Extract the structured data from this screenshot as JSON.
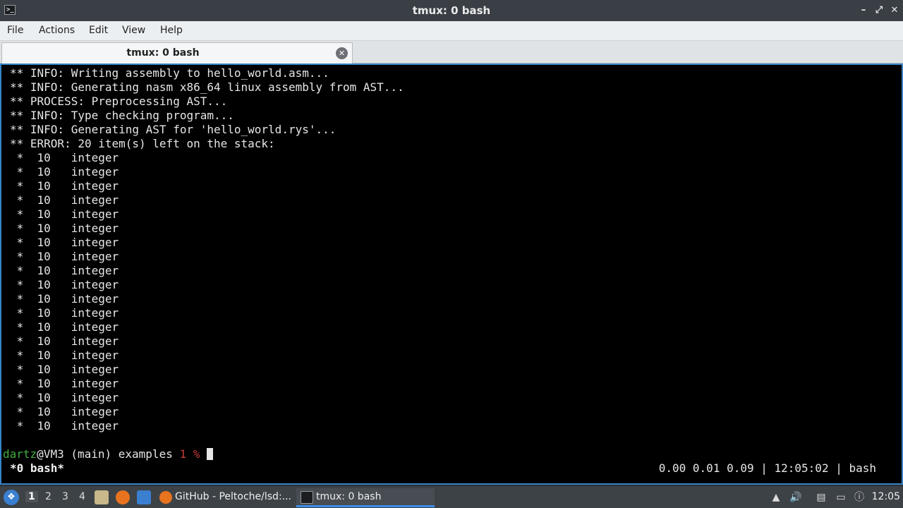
{
  "window": {
    "title": "tmux: 0 bash",
    "minimize": "–",
    "maximize": "⤢",
    "close": "✕"
  },
  "menu": [
    "File",
    "Actions",
    "Edit",
    "View",
    "Help"
  ],
  "tab": {
    "label": "tmux: 0 bash",
    "close": "✕"
  },
  "terminal": {
    "lines": [
      "** INFO: Writing assembly to hello_world.asm...",
      "** INFO: Generating nasm x86_64 linux assembly from AST...",
      "** PROCESS: Preprocessing AST...",
      "** INFO: Type checking program...",
      "** INFO: Generating AST for 'hello_world.rys'...",
      "** ERROR: 20 item(s) left on the stack:",
      " *  10   integer",
      " *  10   integer",
      " *  10   integer",
      " *  10   integer",
      " *  10   integer",
      " *  10   integer",
      " *  10   integer",
      " *  10   integer",
      " *  10   integer",
      " *  10   integer",
      " *  10   integer",
      " *  10   integer",
      " *  10   integer",
      " *  10   integer",
      " *  10   integer",
      " *  10   integer",
      " *  10   integer",
      " *  10   integer",
      " *  10   integer",
      " *  10   integer"
    ],
    "prompt": {
      "user": "dartz",
      "host_rest": "@VM3 (main) examples ",
      "status": "1 %",
      "after": " "
    },
    "status_left": "*0 bash*",
    "status_right": "0.00 0.01 0.09 | 12:05:02 | bash"
  },
  "taskbar": {
    "workspaces": [
      "1",
      "2",
      "3",
      "4"
    ],
    "active_workspace": "1",
    "tasks": [
      {
        "label": "GitHub - Peltoche/lsd:...",
        "icon": "firefox-icon"
      },
      {
        "label": "tmux: 0 bash",
        "icon": "terminal-icon"
      }
    ],
    "clock": "12:05"
  },
  "colors": {
    "accent": "#3584c9",
    "prompt_user": "#3fae3f",
    "prompt_status": "#c83a3a"
  }
}
